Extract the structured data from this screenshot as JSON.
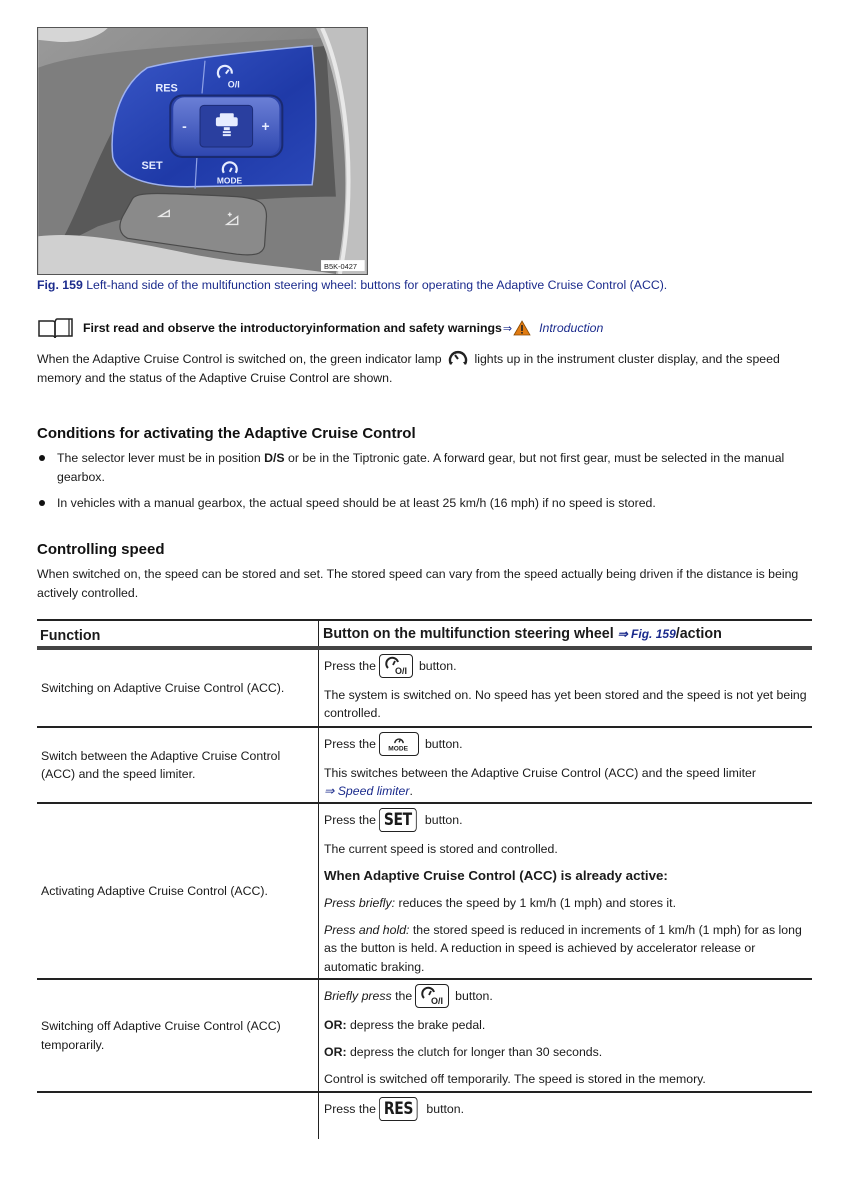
{
  "figure": {
    "labels": {
      "res": "RES",
      "set": "SET",
      "minus": "-",
      "plus": "+",
      "onoff": "O/I",
      "mode": "MODE"
    },
    "code": "B5K-0427",
    "caption_prefix": "Fig. 159",
    "caption": " Left-hand side of the multifunction steering wheel: buttons for operating the Adaptive Cruise Control (ACC)."
  },
  "intro": {
    "text": "First read and observe the introductoryinformation and safety warnings",
    "arrow": "⇒",
    "link": "Introduction"
  },
  "para1": {
    "before": "When the Adaptive Cruise Control is switched on, the green indicator lamp ",
    "after": " lights up in the instrument cluster display, and the speed memory and the status of the Adaptive Cruise Control are shown."
  },
  "conditions": {
    "heading": "Conditions for activating the Adaptive Cruise Control",
    "items": [
      {
        "before": "The selector lever must be in position ",
        "bold": "D/S",
        "after": " or be in the Tiptronic gate. A forward gear, but not first gear, must be selected in the manual gearbox."
      },
      {
        "text": "In vehicles with a manual gearbox, the actual speed should be at least 25 km/h (16 mph) if no speed is stored."
      }
    ]
  },
  "controlling": {
    "heading": "Controlling speed",
    "text": "When switched on, the speed can be stored and set. The stored speed can vary from the speed actually being driven if the distance is being actively controlled."
  },
  "table": {
    "header": {
      "function": "Function",
      "action": "Button on the multifunction steering wheel ",
      "ref": "⇒ Fig. 159",
      "action_suffix": "/action"
    },
    "rows": [
      {
        "function": "Switching on Adaptive Cruise Control (ACC).",
        "press_prefix": "Press the",
        "button": "O/I",
        "press_suffix": "button.",
        "text1": "The system is switched on. No speed has yet been stored and the speed is not yet being controlled."
      },
      {
        "function": "Switch between the Adaptive Cruise Control (ACC) and the speed limiter.",
        "press_prefix": "Press the",
        "button": "MODE",
        "press_suffix": "button.",
        "text1": "This switches between the Adaptive Cruise Control (ACC) and the speed limiter",
        "link": "⇒ Speed limiter",
        "link_suffix": "."
      },
      {
        "function": "Activating Adaptive Cruise Control (ACC).",
        "press_prefix": "Press the",
        "button": "SET",
        "press_suffix": "button.",
        "text1": "The current speed is stored and controlled.",
        "subheading": "When Adaptive Cruise Control (ACC) is already active:",
        "brief_label": "Press briefly:",
        "brief_text": " reduces the speed by 1 km/h (1 mph) and stores it.",
        "hold_label": "Press and hold:",
        "hold_text": " the stored speed is reduced in increments of 1 km/h (1 mph) for as long as the button is held. A reduction in speed is achieved by accelerator release or automatic braking."
      },
      {
        "function": "Switching off Adaptive Cruise Control (ACC) temporarily.",
        "press_prefix_italic": "Briefly press",
        "press_prefix": " the",
        "button": "O/I",
        "press_suffix": "button.",
        "or1_label": "OR:",
        "or1_text": " depress the brake pedal.",
        "or2_label": "OR:",
        "or2_text": " depress the clutch for longer than 30 seconds.",
        "text1": "Control is switched off temporarily. The speed is stored in the memory."
      },
      {
        "function": "",
        "press_prefix": "Press the",
        "button": "RES",
        "press_suffix": "button."
      }
    ]
  }
}
